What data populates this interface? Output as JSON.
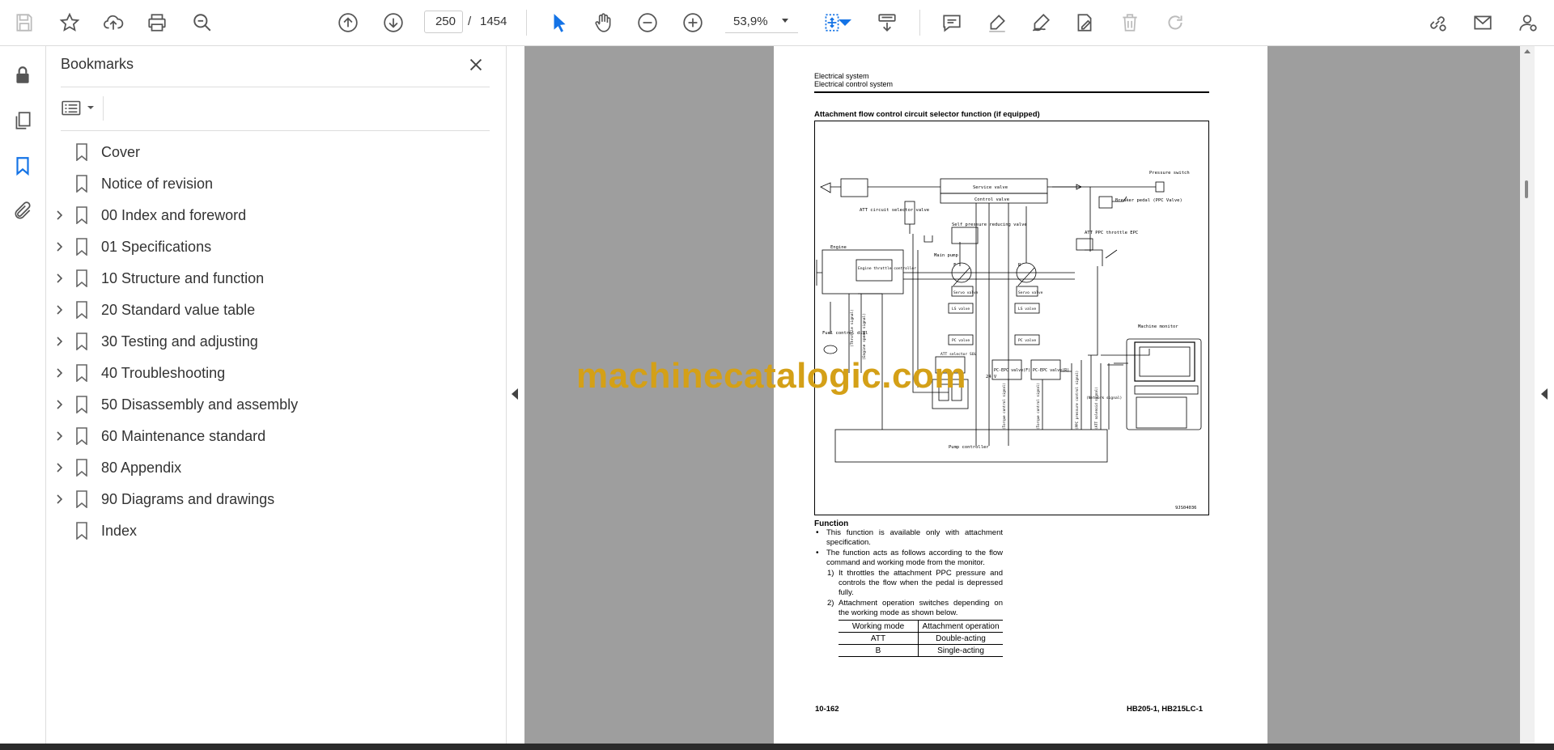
{
  "toolbar": {
    "page_current": "250",
    "page_separator": "/",
    "page_total": "1454",
    "zoom": "53,9%"
  },
  "bookmarks_panel": {
    "title": "Bookmarks",
    "items": [
      {
        "label": "Cover",
        "expandable": false
      },
      {
        "label": "Notice of revision",
        "expandable": false
      },
      {
        "label": "00 Index and foreword",
        "expandable": true
      },
      {
        "label": "01 Specifications",
        "expandable": true
      },
      {
        "label": "10 Structure and function",
        "expandable": true
      },
      {
        "label": "20 Standard value table",
        "expandable": true
      },
      {
        "label": "30 Testing and adjusting",
        "expandable": true
      },
      {
        "label": "40 Troubleshooting",
        "expandable": true
      },
      {
        "label": "50 Disassembly and assembly",
        "expandable": true
      },
      {
        "label": "60 Maintenance standard",
        "expandable": true
      },
      {
        "label": "80 Appendix",
        "expandable": true
      },
      {
        "label": "90 Diagrams and drawings",
        "expandable": true
      },
      {
        "label": "Index",
        "expandable": false
      }
    ]
  },
  "document": {
    "header_line1": "Electrical system",
    "header_line2": "Electrical control system",
    "section_title": "Attachment flow control circuit selector function (if equipped)",
    "diagram": {
      "service_valve": "Service valve",
      "control_valve": "Control valve",
      "pressure_switch": "Pressure switch",
      "breaker_pedal": "Breaker pedal (PPC Valve)",
      "att_circuit_selector": "ATT circuit selector valve",
      "self_pressure": "Self pressure reducing valve",
      "att_ppc_epc": "ATT PPC throttle EPC",
      "engine": "Engine",
      "engine_throttle": "Engine throttle controller",
      "main_pump": "Main pump",
      "f": "F",
      "r": "R",
      "servo_valve": "Servo valve",
      "ls_valve": "LS valve",
      "pc_valve": "PC valve",
      "fuel_dial": "Fuel control dial",
      "throttle_signal": "(Throttle signal)",
      "engine_speed_signal": "(Engine speed signal)",
      "att_selector_sol": "ATT selector SOL",
      "pc_epc_f": "PC-EPC valve(F)",
      "pc_epc_r": "PC-EPC valve(R)",
      "v24": "24 V",
      "machine_monitor": "Machine monitor",
      "network_signal": "(Network signal)",
      "pump_controller": "Pump controller",
      "sig_a": "(Torque control signal)",
      "sig_b": "(Torque control signal)",
      "sig_c": "(PPC pressure control signal)",
      "sig_d": "(ATT solenoid signal)",
      "fig_code": "9JS04036"
    },
    "function_heading": "Function",
    "bullet1": "This function is available only with attachment specification.",
    "bullet2": "The function acts as follows according to the flow command and working mode from the monitor.",
    "item1": "It throttles the attachment PPC pressure and controls the flow when the pedal is depressed fully.",
    "item2": "Attachment operation switches depending on the working mode as shown below.",
    "table_headers": [
      "Working mode",
      "Attachment operation"
    ],
    "table_rows": [
      [
        "ATT",
        "Double-acting"
      ],
      [
        "B",
        "Single-acting"
      ]
    ],
    "footer_left": "10-162",
    "footer_right": "HB205-1, HB215LC-1"
  },
  "watermark": "machinecatalogic.com"
}
